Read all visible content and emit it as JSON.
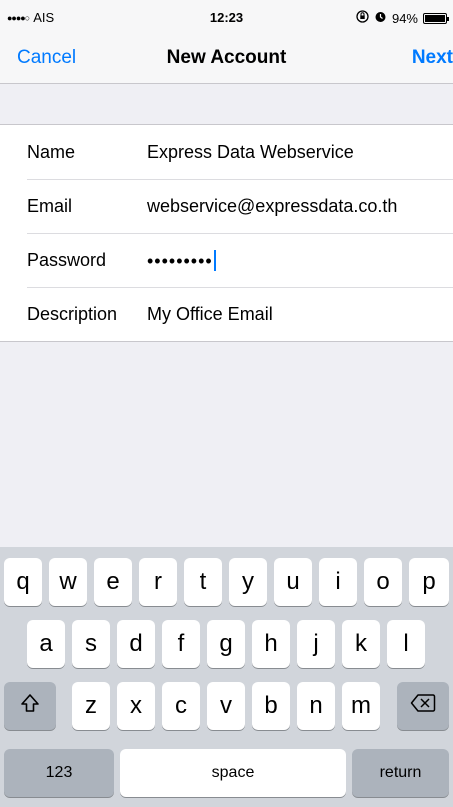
{
  "status_bar": {
    "carrier": "AIS",
    "signal": "●●●●○",
    "time": "12:23",
    "battery": "94%"
  },
  "nav": {
    "cancel": "Cancel",
    "title": "New Account",
    "next": "Next"
  },
  "form": {
    "name_label": "Name",
    "name_value": "Express Data Webservice",
    "email_label": "Email",
    "email_value": "webservice@expressdata.co.th",
    "password_label": "Password",
    "password_value": "•••••••••",
    "description_label": "Description",
    "description_value": "My Office Email"
  },
  "keyboard": {
    "row1": [
      "q",
      "w",
      "e",
      "r",
      "t",
      "y",
      "u",
      "i",
      "o",
      "p"
    ],
    "row2": [
      "a",
      "s",
      "d",
      "f",
      "g",
      "h",
      "j",
      "k",
      "l"
    ],
    "row3": [
      "z",
      "x",
      "c",
      "v",
      "b",
      "n",
      "m"
    ],
    "shift": "⇧",
    "delete": "⌫",
    "numbers": "123",
    "space": "space",
    "return": "return"
  }
}
